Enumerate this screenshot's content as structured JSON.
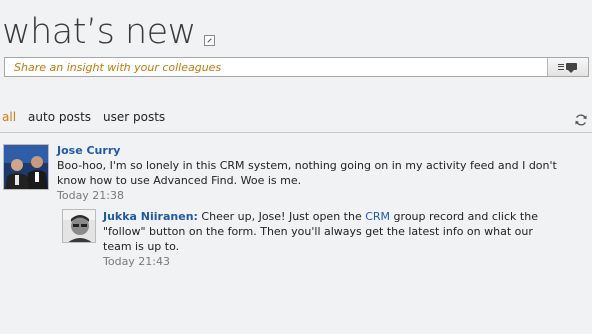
{
  "page": {
    "title": "what’s new"
  },
  "share": {
    "placeholder": "Share an insight with your colleagues"
  },
  "tabs": [
    {
      "label": "all",
      "active": true
    },
    {
      "label": "auto posts",
      "active": false
    },
    {
      "label": "user posts",
      "active": false
    }
  ],
  "posts": [
    {
      "author": "Jose Curry",
      "text": "Boo-hoo, I'm so lonely in this CRM system, nothing going on in my activity feed and I don't know how to use Advanced Find. Woe is me.",
      "time": "Today 21:38"
    }
  ],
  "reply": {
    "author": "Jukka Niiranen:",
    "text_before": " Cheer up, Jose! Just open the ",
    "link": "CRM",
    "text_after": " group record and click the \"follow\" button on the form. Then you'll always get the latest info on what our team is up to.",
    "time": "Today 21:43"
  },
  "icons": {
    "popout": "popout-icon",
    "post": "post-comment-icon",
    "refresh": "refresh-icon"
  },
  "colors": {
    "accent_orange": "#e07b00",
    "link_blue": "#1f5aa6",
    "placeholder_orange": "#c07a00"
  }
}
